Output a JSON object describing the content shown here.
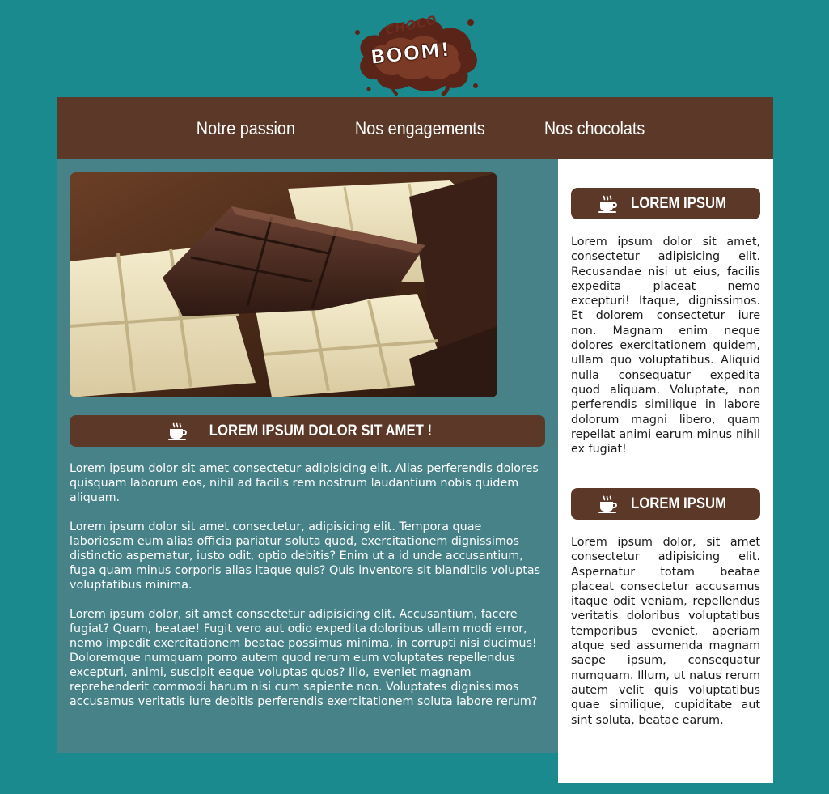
{
  "logo": {
    "line1": "CHOCO",
    "line2": "BOOM!",
    "colors": {
      "splash": "#5a2418",
      "text": "#ffffff"
    }
  },
  "nav": {
    "items": [
      {
        "label": "Notre passion"
      },
      {
        "label": "Nos engagements"
      },
      {
        "label": "Nos chocolats"
      }
    ]
  },
  "main": {
    "hero": {
      "subject": "chocolate-bars-photo"
    },
    "title": "LOREM IPSUM DOLOR SIT AMET !",
    "paragraphs": [
      "Lorem ipsum dolor sit amet consectetur adipisicing elit. Alias perferendis dolores quisquam laborum eos, nihil ad facilis rem nostrum laudantium nobis quidem aliquam.",
      "Lorem ipsum dolor sit amet consectetur, adipisicing elit. Tempora quae laboriosam eum alias officia pariatur soluta quod, exercitationem dignissimos distinctio aspernatur, iusto odit, optio debitis? Enim ut a id unde accusantium, fuga quam minus corporis alias itaque quis? Quis inventore sit blanditiis voluptas voluptatibus minima.",
      "Lorem ipsum dolor, sit amet consectetur adipisicing elit. Accusantium, facere fugiat? Quam, beatae! Fugit vero aut odio expedita doloribus ullam modi error, nemo impedit exercitationem beatae possimus minima, in corrupti nisi ducimus! Doloremque numquam porro autem quod rerum eum voluptates repellendus excepturi, animi, suscipit eaque voluptas quos? Illo, eveniet magnam reprehenderit commodi harum nisi cum sapiente non. Voluptates dignissimos accusamus veritatis iure debitis perferendis exercitationem soluta labore rerum?"
    ]
  },
  "sidebar": {
    "sections": [
      {
        "title": "LOREM IPSUM",
        "text": "Lorem ipsum dolor sit amet, consectetur adipisicing elit. Recusandae nisi ut eius, facilis expedita placeat nemo excepturi! Itaque, dignissimos. Et dolorem consectetur iure non. Magnam enim neque dolores exercitationem quidem, ullam quo voluptatibus. Aliquid nulla consequatur expedita quod aliquam. Voluptate, non perferendis similique in labore dolorum magni libero, quam repellat animi earum minus nihil ex fugiat!"
      },
      {
        "title": "LOREM IPSUM",
        "text": "Lorem ipsum dolor, sit amet consectetur adipisicing elit. Aspernatur totam beatae placeat consectetur accusamus itaque odit veniam, repellendus veritatis doloribus voluptatibus temporibus eveniet, aperiam atque sed assumenda magnam saepe ipsum, consequatur numquam. Illum, ut natus rerum autem velit quis voluptatibus quae similique, cupiditate aut sint soluta, beatae earum."
      }
    ]
  },
  "icons": {
    "section": "coffee-cup-icon"
  },
  "colors": {
    "background": "#1b8a8f",
    "brown": "#5c3828",
    "main_panel": "#468288",
    "sidebar": "#ffffff"
  }
}
